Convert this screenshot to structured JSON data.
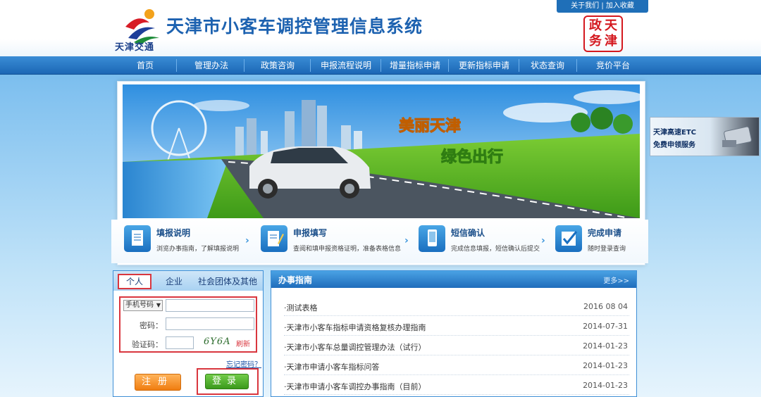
{
  "header": {
    "site_title": "天津市小客车调控管理信息系统",
    "logo_text": "天津交通",
    "top_links": [
      "关于我们",
      "加入收藏"
    ],
    "seal_chars": [
      "天",
      "津",
      "政",
      "务"
    ]
  },
  "nav": {
    "items": [
      "首页",
      "管理办法",
      "政策咨询",
      "申报流程说明",
      "增量指标申请",
      "更新指标申请",
      "状态查询",
      "竞价平台"
    ]
  },
  "banner": {
    "slogan1": "美丽天津",
    "slogan2": "绿色出行"
  },
  "steps": [
    {
      "title": "填报说明",
      "desc": "浏览办事指南，了解填报说明"
    },
    {
      "title": "申报填写",
      "desc": "查阅和填申报资格证明，准备表格信息"
    },
    {
      "title": "短信确认",
      "desc": "完成信息填报，短信确认后提交"
    },
    {
      "title": "完成申请",
      "desc": "随时登录查询"
    }
  ],
  "etc_ad": {
    "line1": "天津高速ETC",
    "line2": "免费申领服务"
  },
  "login": {
    "tabs": [
      "个人",
      "企业",
      "社会团体及其他"
    ],
    "type_select": "手机号码",
    "password_label": "密码：",
    "captcha_label": "验证码：",
    "captcha_text": "6Y6A",
    "refresh": "刷新",
    "forgot": "忘记密码？",
    "register": "注册",
    "login_btn": "登录"
  },
  "guide": {
    "title": "办事指南",
    "more": "更多>>",
    "rows": [
      {
        "title": "·测试表格",
        "date": "2016 08 04"
      },
      {
        "title": "·天津市小客车指标申请资格复核办理指南",
        "date": "2014-07-31"
      },
      {
        "title": "·天津市小客车总量调控管理办法（试行）",
        "date": "2014-01-23"
      },
      {
        "title": "·天津市申请小客车指标问答",
        "date": "2014-01-23"
      },
      {
        "title": "·天津市申请小客车调控办事指南（目前）",
        "date": "2014-01-23"
      }
    ]
  },
  "colors": {
    "brand": "#1d62b0",
    "nav": "#1c67b5",
    "alert_red": "#d9363e",
    "login_green": "#3b9a1c",
    "register_orange": "#f07d10"
  }
}
